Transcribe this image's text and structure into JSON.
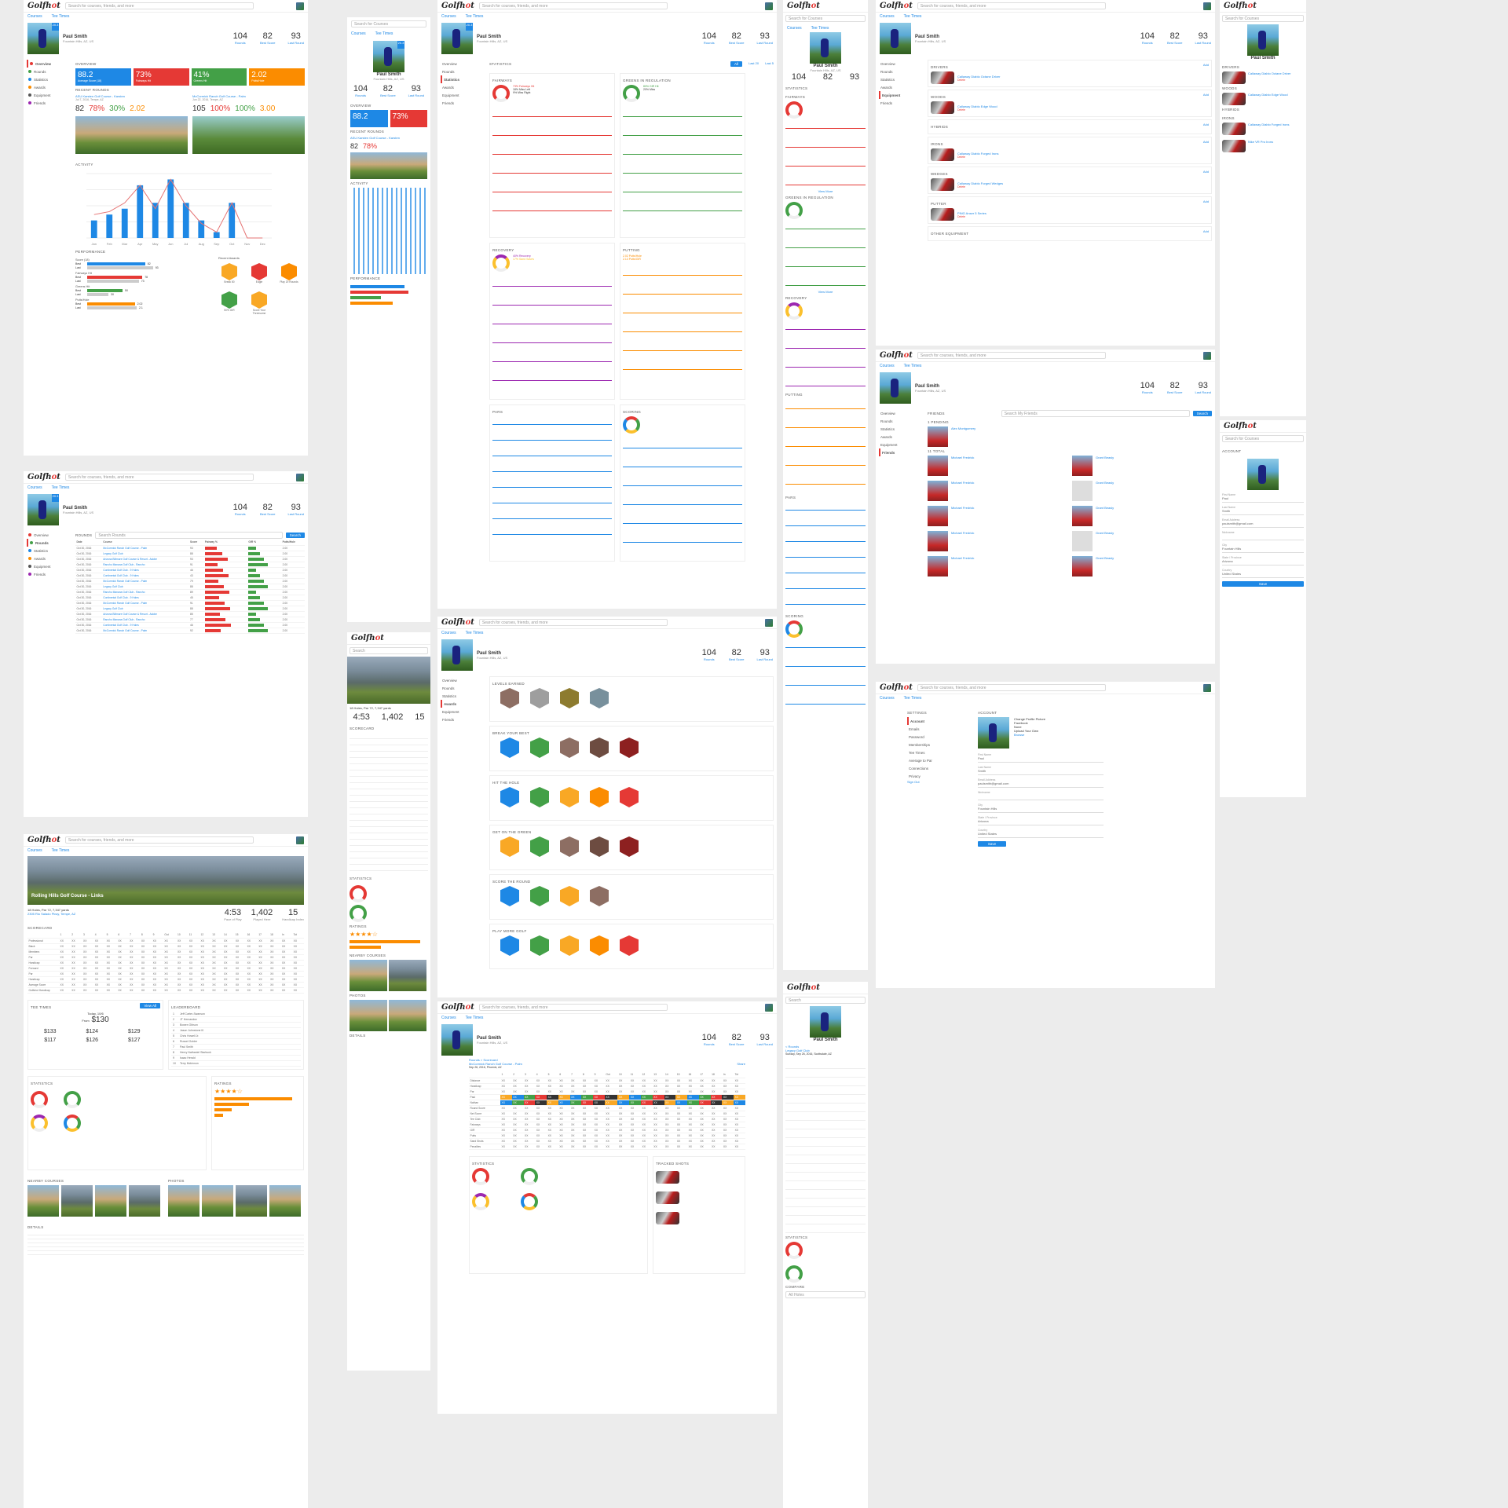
{
  "app": {
    "logo_pre": "Golfh",
    "logo_o": "o",
    "logo_post": "t",
    "search_placeholder": "Search for courses, friends, and more",
    "search_short": "Search for Courses",
    "search_tiny": "Search",
    "nav_courses": "Courses",
    "nav_tee": "Tee Times"
  },
  "profile": {
    "name": "Paul Smith",
    "location": "Fountain Hills, AZ, US",
    "badge": "20.3",
    "rounds": "104",
    "rounds_label": "Rounds",
    "best": "82",
    "best_label": "Best Score",
    "last": "93",
    "last_label": "Last Round"
  },
  "sidebar": [
    "Overview",
    "Rounds",
    "Statistics",
    "Awards",
    "Equipment",
    "Friends"
  ],
  "overview": {
    "title": "OVERVIEW",
    "tiles": [
      {
        "v": "88.2",
        "l": "Average Score (18)",
        "c": "#1e88e5"
      },
      {
        "v": "73%",
        "l": "Fairways Hit",
        "c": "#e53935"
      },
      {
        "v": "41%",
        "l": "Greens Hit",
        "c": "#43a047"
      },
      {
        "v": "2.02",
        "l": "Putts/Hole",
        "c": "#fb8c00"
      }
    ],
    "recent_title": "RECENT ROUNDS",
    "rounds": [
      {
        "course": "ASU Karsten Golf Course - Karsten",
        "date": "Jul 7, 2016, Tempe, AZ",
        "score": "82",
        "fw": "78%",
        "gir": "30%",
        "putts": "2.02"
      },
      {
        "course": "McCormick Ranch Golf Course - Palm",
        "date": "Jun 22, 2016, Tempe, AZ",
        "score": "105",
        "fw": "100%",
        "gir": "100%",
        "putts": "3.00"
      }
    ],
    "activity_title": "ACTIVITY",
    "activity_year": "2016",
    "rounds_played": "Rounds Played",
    "best_score": "Best Score",
    "performance_title": "PERFORMANCE",
    "recent_awards": "Recent Awards"
  },
  "chart_data": {
    "type": "bar",
    "categories": [
      "Jan",
      "Feb",
      "Mar",
      "Apr",
      "May",
      "Jun",
      "Jul",
      "Aug",
      "Sep",
      "Oct",
      "Nov",
      "Dec"
    ],
    "series": [
      {
        "name": "Rounds Played",
        "values": [
          3,
          4,
          5,
          9,
          6,
          10,
          6,
          3,
          1,
          6,
          0,
          0
        ]
      },
      {
        "name": "Best Score",
        "values": [
          8,
          9,
          12,
          18,
          10,
          20,
          11,
          5,
          2,
          12,
          0,
          0
        ]
      }
    ],
    "ylim": [
      0,
      22
    ]
  },
  "perf": [
    {
      "l": "Score (18)",
      "best": 82,
      "last": 93
    },
    {
      "l": "Fairways Hit",
      "best": 78,
      "last": 73
    },
    {
      "l": "Greens Hit",
      "best": 50,
      "last": 30
    },
    {
      "l": "Putts/Hole",
      "best": 2.02,
      "last": 2.1
    }
  ],
  "awards": [
    {
      "t": "Break 80",
      "c": "#f9a825"
    },
    {
      "t": "Eagle",
      "c": "#e53935"
    },
    {
      "t": "Play 20 Rounds",
      "c": "#fb8c00"
    },
    {
      "t": "50% GIR",
      "c": "#43a047"
    },
    {
      "t": "Score Your Threesome",
      "c": "#f9a825"
    }
  ],
  "rounds_table": {
    "title": "ROUNDS",
    "search": "Search Rounds",
    "btn": "Search",
    "headers": [
      "Date",
      "Course",
      "Score",
      "Fairway %",
      "GIR %",
      "Putts/Hole"
    ],
    "rows": [
      [
        "Oct 30, 2016",
        "McCormick Ranch Golf Course - Palm",
        "93",
        "",
        "",
        "2.00"
      ],
      [
        "Oct 30, 2016",
        "Legacy Golf Club",
        "88",
        "",
        "",
        "2.00"
      ],
      [
        "Oct 30, 2016",
        "Arizona Biltmore Golf Course & Resort - Adobe",
        "93",
        "",
        "",
        "2.00"
      ],
      [
        "Oct 30, 2016",
        "Rancho Manana Golf Club - Rancho",
        "91",
        "",
        "",
        "2.00"
      ],
      [
        "Oct 30, 2016",
        "Continental Golf Club - 9 Holes",
        "46",
        "",
        "",
        "2.00"
      ],
      [
        "Oct 30, 2016",
        "Continental Golf Club - 9 Holes",
        "43",
        "",
        "",
        "2.00"
      ],
      [
        "Oct 30, 2016",
        "McCormick Ranch Golf Course - Palm",
        "79",
        "",
        "",
        "2.00"
      ],
      [
        "Oct 30, 2016",
        "Legacy Golf Club",
        "88",
        "",
        "",
        "2.00"
      ],
      [
        "Oct 30, 2016",
        "Rancho Manana Golf Club - Rancho",
        "89",
        "",
        "",
        "2.00"
      ],
      [
        "Oct 30, 2016",
        "Continental Golf Club - 9 Holes",
        "45",
        "",
        "",
        "2.00"
      ],
      [
        "Oct 30, 2016",
        "McCormick Ranch Golf Course - Palm",
        "91",
        "",
        "",
        "2.00"
      ],
      [
        "Oct 30, 2016",
        "Legacy Golf Club",
        "88",
        "",
        "",
        "2.00"
      ],
      [
        "Oct 30, 2016",
        "Arizona Biltmore Golf Course & Resort - Adobe",
        "85",
        "",
        "",
        "2.00"
      ],
      [
        "Oct 30, 2016",
        "Rancho Manana Golf Club - Rancho",
        "77",
        "",
        "",
        "2.00"
      ],
      [
        "Oct 30, 2016",
        "Continental Golf Club - 9 Holes",
        "46",
        "",
        "",
        "2.00"
      ],
      [
        "Oct 30, 2016",
        "McCormick Ranch Golf Course - Palm",
        "92",
        "",
        "",
        "2.00"
      ]
    ]
  },
  "course": {
    "name": "Rolling Hills Golf Course - Links",
    "info": "18 Holes, Par 72, 7,347 yards",
    "addr": "2305 Rio Salado Pkwy, Tempe, AZ",
    "pace": "4:53",
    "pace_l": "Pace of Play",
    "players": "1,402",
    "players_l": "Played Here",
    "handicap": "15",
    "handicap_l": "Handicap Index",
    "scorecard": "SCORECARD",
    "tee_times": "TEE TIMES",
    "view_all": "View All",
    "today": "Today, 10/6",
    "from": "From",
    "price": "$130",
    "leaderboard": "LEADERBOARD",
    "statistics": "STATISTICS",
    "ratings": "RATINGS",
    "nearby": "NEARBY COURSES",
    "photos": "PHOTOS",
    "details": "DETAILS"
  },
  "tee_prices": [
    "$133",
    "$124",
    "$129",
    "$117",
    "$126",
    "$127"
  ],
  "leaders": [
    "Jeff Carter-Swanson",
    "JT Hernandez",
    "Bowen Gibson",
    "Jason Johnstone III",
    "Chris Howell Jr.",
    "Russel Golder",
    "Paul Smith",
    "Henry Nathaniel Starbuck",
    "Isaac Herald",
    "Terry Mckinnon"
  ],
  "stats_page": {
    "title": "STATISTICS",
    "filters": [
      "All",
      "Last 20",
      "Last 5"
    ],
    "fairways": "FAIRWAYS",
    "fw_hit": "73% Fairways Hit",
    "fw_left": "18% Miss Left",
    "fw_right": "9% Miss Right",
    "gir": "GREENS IN REGULATION",
    "gir_hit": "80% GIR Hit",
    "gir_miss": "20% Miss",
    "recovery": "RECOVERY",
    "rec1": "40% Recovery",
    "rec2": "17% Sand Saves",
    "putting": "PUTTING",
    "put1": "2.02 Putts/Hole",
    "put2": "2.13 Putts/GIR",
    "pars": "PARS",
    "scoring": "SCORING",
    "view_more": "View More"
  },
  "equipment": {
    "drivers": "DRIVERS",
    "woods": "WOODS",
    "hybrids": "HYBRIDS",
    "irons": "IRONS",
    "wedges": "WEDGES",
    "putter": "PUTTER",
    "other": "OTHER EQUIPMENT",
    "items": [
      "Callaway Diablo Octane Driver",
      "Callaway Diablo Edge Wood",
      "Callaway Diablo Forged Irons",
      "Nike VR Pro Irons",
      "Callaway Diablo Forged Wedges",
      "PING Anser 5 Series"
    ],
    "delete": "Delete",
    "add": "Add"
  },
  "friends": {
    "title": "FRIENDS",
    "search": "Search My Friends",
    "btn": "Search",
    "pending": "1 PENDING",
    "total": "11 TOTAL",
    "names": [
      "Alex Montgomery",
      "Michael Fredrick",
      "Grant Beasly",
      "Michael Fredrick",
      "Grant Beasly",
      "Michael Fredrick",
      "Grant Beasly"
    ]
  },
  "awards_page": {
    "levels": "LEVELS EARNED",
    "break": "BREAK YOUR BEST",
    "hole": "HIT THE HOLE",
    "green": "GET ON THE GREEN",
    "score": "SCORE THE ROUND",
    "play": "PLAY MORE GOLF",
    "level_names": [
      "Bronze",
      "Silver",
      "Gold",
      "Platinum"
    ]
  },
  "settings": {
    "title": "SETTINGS",
    "account": "ACCOUNT",
    "menu": [
      "Account",
      "Emails",
      "Password",
      "Memberships",
      "Tee Times",
      "Average to Par",
      "Connections",
      "Privacy"
    ],
    "sign_out": "Sign Out",
    "photo": "Change Profile Picture",
    "opts": [
      "Facebook",
      "None",
      "Upload Your Own",
      "Browse"
    ],
    "first": "First Name",
    "first_v": "Paul",
    "last": "Last Name",
    "last_v": "Smith",
    "email": "Email Address",
    "email_v": "paulsmith@gmail.com",
    "nick": "Nickname",
    "city": "City",
    "city_v": "Fountain Hills",
    "state": "State / Province",
    "state_v": "Arizona",
    "country": "Country",
    "country_v": "United States",
    "save": "Save"
  },
  "round_detail": {
    "crumb": "Rounds > Scorecard",
    "course": "McCormick Ranch Golf Course - Palm",
    "date": "Sep 26, 2016, Phoenix, AZ",
    "share": "Share",
    "tracked": "TRACKED SHOTS",
    "players": [
      "Paul",
      "Nathan"
    ],
    "rows": [
      "Distance",
      "Handicap",
      "Par",
      "Paul",
      "Nathan",
      "Round Score",
      "Net Score",
      "Tee Club",
      "Fairways",
      "GIR",
      "Putts",
      "Sand Shots",
      "Penalties"
    ]
  },
  "mobile": {
    "rounds_back": "< Rounds",
    "compare": "COMPARE",
    "all_holes": "All Holes",
    "course_short": "Legacy Golf Club",
    "date_short": "Sunday, Sep 26, 2016, Scottsdale, AZ"
  }
}
